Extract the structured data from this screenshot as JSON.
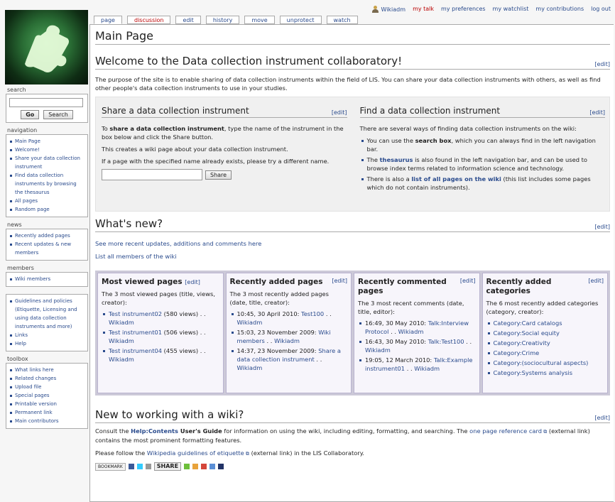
{
  "personal": {
    "username": "Wikiadm",
    "mytalk": "my talk",
    "preferences": "my preferences",
    "watchlist": "my watchlist",
    "contributions": "my contributions",
    "logout": "log out"
  },
  "tabs": [
    "page",
    "discussion",
    "edit",
    "history",
    "move",
    "unprotect",
    "watch"
  ],
  "sidebar": {
    "search_title": "search",
    "go_label": "Go",
    "search_label": "Search",
    "navigation_title": "navigation",
    "navigation": [
      "Main Page",
      "Welcome!",
      "Share your data collection instrument",
      "Find data collection instruments by browsing the thesaurus",
      "All pages",
      "Random page"
    ],
    "news_title": "news",
    "news": [
      "Recently added pages",
      "Recent updates & new members"
    ],
    "members_title": "members",
    "members": [
      "Wiki members"
    ],
    "misc": [
      "Guidelines and policies (Etiquette, Licensing and using data collection instruments and more)",
      "Links",
      "Help"
    ],
    "toolbox_title": "toolbox",
    "toolbox": [
      "What links here",
      "Related changes",
      "Upload file",
      "Special pages",
      "Printable version",
      "Permanent link",
      "Main contributors"
    ]
  },
  "main": {
    "page_title": "Main Page",
    "welcome_heading": "Welcome to the Data collection instrument collaboratory!",
    "edit": "[edit]",
    "intro": "The purpose of the site is to enable sharing of data collection instruments within the field of LIS. You can share your data collection instruments with others, as well as find other people's data collection instruments to use in your studies.",
    "share": {
      "heading": "Share a data collection instrument",
      "p1a": "To ",
      "p1b": "share a data collection instrument",
      "p1c": ", type the name of the instrument in the box below and click the Share button.",
      "p2": "This creates a wiki page about your data collection instrument.",
      "p3": "If a page with the specified name already exists, please try a different name.",
      "button": "Share"
    },
    "find": {
      "heading": "Find a data collection instrument",
      "intro": "There are several ways of finding data collection instruments on the wiki:",
      "b1a": "You can use the ",
      "b1b": "search box",
      "b1c": ", which you can always find in the left navigation bar.",
      "b2a": "The ",
      "b2b": "thesaurus",
      "b2c": " is also found in the left navigation bar, and can be used to browse index terms related to information science and technology.",
      "b3a": "There is also a ",
      "b3b": "list of all pages on the wiki",
      "b3c": " (this list includes some pages which do not contain instruments)."
    },
    "whatsnew_heading": "What's new?",
    "link_updates": "See more recent updates, additions and comments here",
    "link_members": "List all members of the wiki",
    "panels": {
      "viewed": {
        "title": "Most viewed pages",
        "desc_a": "The ",
        "desc_b": "3",
        "desc_c": " most viewed pages (title, views, creator):",
        "items": [
          {
            "link": "Test instrument02",
            "rest": " (580 views) . . ",
            "user": "Wikiadm"
          },
          {
            "link": "Test instrument01",
            "rest": " (506 views) . . ",
            "user": "Wikiadm"
          },
          {
            "link": "Test instrument04",
            "rest": " (455 views) . . ",
            "user": "Wikiadm"
          }
        ]
      },
      "added": {
        "title": "Recently added pages",
        "desc": "The 3 most recently added pages (date, title, creator):",
        "items": [
          {
            "date": "10:45, 30 April 2010: ",
            "link": "Test100",
            "rest": " . . ",
            "user": "Wikiadm"
          },
          {
            "date": "15:03, 23 November 2009: ",
            "link": "Wiki members",
            "rest": " . . ",
            "user": "Wikiadm"
          },
          {
            "date": "14:37, 23 November 2009: ",
            "link": "Share a data collection instrument",
            "rest": " . . ",
            "user": "Wikiadm"
          }
        ]
      },
      "commented": {
        "title": "Recently commented pages",
        "desc": "The 3 most recent comments (date, title, editor):",
        "items": [
          {
            "date": "16:49, 30 May 2010: ",
            "link": "Talk:Interview Protocol",
            "rest": " . . ",
            "user": "Wikiadm"
          },
          {
            "date": "16:43, 30 May 2010: ",
            "link": "Talk:Test100",
            "rest": " . . ",
            "user": "Wikiadm"
          },
          {
            "date": "19:05, 12 March 2010: ",
            "link": "Talk:Example instrument01",
            "rest": " . . ",
            "user": "Wikiadm"
          }
        ]
      },
      "categories": {
        "title": "Recently added categories",
        "desc": "The 6 most recently added categories (category, creator):",
        "items": [
          "Category:Card catalogs",
          "Category:Social equity",
          "Category:Creativity",
          "Category:Crime",
          "Category:(sociocultural aspects)",
          "Category:Systems analysis"
        ]
      }
    },
    "newwiki": {
      "heading": "New to working with a wiki?",
      "p1a": "Consult the ",
      "p1b": "Help:Contents",
      "p1c": " User's Guide",
      "p1d": " for information on using the wiki, including editing, formatting, and searching. The ",
      "p1e": "one page reference card",
      "p1f": " (external link) contains the most prominent formatting features.",
      "p2a": "Please follow the ",
      "p2b": "Wikipedia guidelines of etiquette",
      "p2c": " (external link) in the LIS Collaboratory.",
      "bookmark": "BOOKMARK",
      "share_badge": "SHARE"
    }
  }
}
